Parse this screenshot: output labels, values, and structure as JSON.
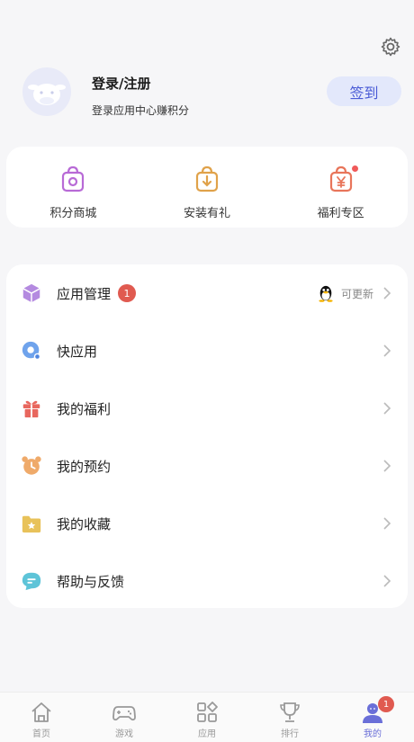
{
  "header": {
    "settings_icon": "gear-icon"
  },
  "profile": {
    "title": "登录/注册",
    "subtitle": "登录应用中心赚积分",
    "signin_label": "签到"
  },
  "quick_actions": [
    {
      "label": "积分商城",
      "icon": "shopping-bag-icon",
      "color": "#b86ad6"
    },
    {
      "label": "安装有礼",
      "icon": "download-bag-icon",
      "color": "#e0a24a"
    },
    {
      "label": "福利专区",
      "icon": "yen-bag-icon",
      "color": "#e8755a"
    }
  ],
  "menu": [
    {
      "label": "应用管理",
      "badge": "1",
      "right_text": "可更新",
      "icon": "cube-icon"
    },
    {
      "label": "快应用",
      "icon": "quick-app-icon"
    },
    {
      "label": "我的福利",
      "icon": "gift-icon"
    },
    {
      "label": "我的预约",
      "icon": "alarm-clock-icon"
    },
    {
      "label": "我的收藏",
      "icon": "star-folder-icon"
    },
    {
      "label": "帮助与反馈",
      "icon": "chat-bubble-icon"
    }
  ],
  "tabs": [
    {
      "label": "首页",
      "icon": "home-icon",
      "active": false
    },
    {
      "label": "游戏",
      "icon": "gamepad-icon",
      "active": false
    },
    {
      "label": "应用",
      "icon": "apps-icon",
      "active": false
    },
    {
      "label": "排行",
      "icon": "trophy-icon",
      "active": false
    },
    {
      "label": "我的",
      "icon": "profile-icon",
      "active": true,
      "badge": "1"
    }
  ],
  "colors": {
    "accent": "#6a6fd8",
    "badge": "#e05a50",
    "signin_bg": "#e3e8fb",
    "signin_text": "#4a5bd6"
  }
}
